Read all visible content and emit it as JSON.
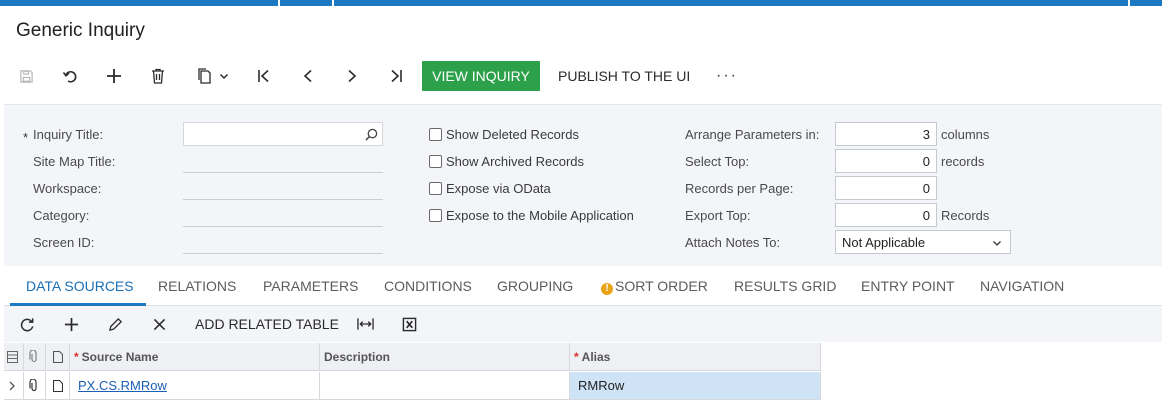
{
  "page": {
    "title": "Generic Inquiry"
  },
  "toolbar": {
    "view_inquiry_label": "VIEW INQUIRY",
    "publish_label": "PUBLISH TO THE UI",
    "more_label": "···"
  },
  "form": {
    "required_mark": "*",
    "inquiry_title_label": "Inquiry Title:",
    "site_map_title_label": "Site Map Title:",
    "workspace_label": "Workspace:",
    "category_label": "Category:",
    "screen_id_label": "Screen ID:",
    "show_deleted_label": "Show Deleted Records",
    "show_archived_label": "Show Archived Records",
    "expose_odata_label": "Expose via OData",
    "expose_mobile_label": "Expose to the Mobile Application",
    "arrange_params_label": "Arrange Parameters in:",
    "arrange_params_value": "3",
    "arrange_params_suffix": "columns",
    "select_top_label": "Select Top:",
    "select_top_value": "0",
    "select_top_suffix": "records",
    "records_per_page_label": "Records per Page:",
    "records_per_page_value": "0",
    "export_top_label": "Export Top:",
    "export_top_value": "0",
    "export_top_suffix": "Records",
    "attach_notes_label": "Attach Notes To:",
    "attach_notes_value": "Not Applicable"
  },
  "tabs": [
    {
      "label": "DATA SOURCES",
      "active": true
    },
    {
      "label": "RELATIONS"
    },
    {
      "label": "PARAMETERS"
    },
    {
      "label": "CONDITIONS"
    },
    {
      "label": "GROUPING"
    },
    {
      "label": "SORT ORDER",
      "warning": true
    },
    {
      "label": "RESULTS GRID"
    },
    {
      "label": "ENTRY POINT"
    },
    {
      "label": "NAVIGATION"
    }
  ],
  "grid_toolbar": {
    "add_related_table_label": "ADD RELATED TABLE"
  },
  "grid": {
    "required_mark": "*",
    "columns": {
      "source_name": "Source Name",
      "description": "Description",
      "alias": "Alias"
    },
    "rows": [
      {
        "source_name": "PX.CS.RMRow",
        "description": "",
        "alias": "RMRow"
      }
    ]
  },
  "colors": {
    "accent": "#1e79c3",
    "primary_button": "#2ca04a",
    "selected_row": "#cfe3f6"
  }
}
